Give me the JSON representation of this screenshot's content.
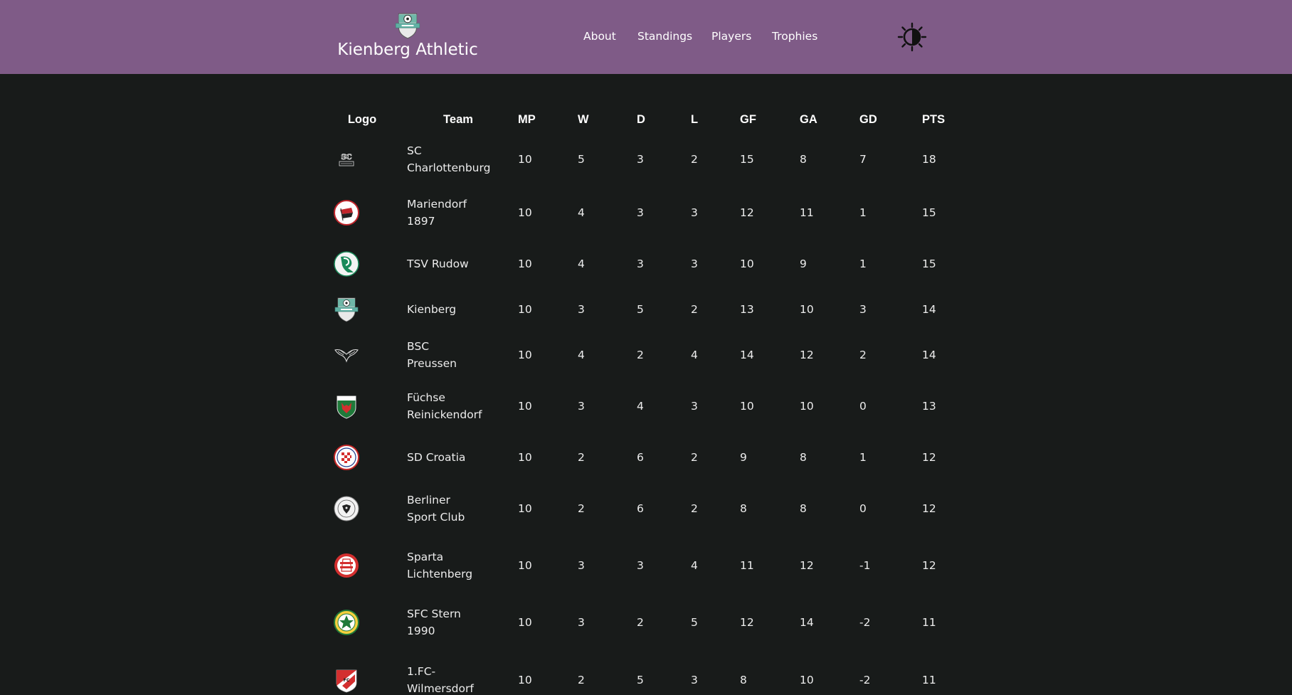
{
  "header": {
    "brand_name": "Kienberg Athletic",
    "logo_icon": "kienberg-crest-icon",
    "nav": [
      "About",
      "Standings",
      "Players",
      "Trophies"
    ],
    "theme_toggle_icon": "contrast-sun-icon",
    "colors": {
      "background": "#7f5b87"
    }
  },
  "table": {
    "columns": [
      "Logo",
      "Team",
      "MP",
      "W",
      "D",
      "L",
      "GF",
      "GA",
      "GD",
      "PTS"
    ],
    "rows": [
      {
        "logo": "sc-charlottenburg-crest-icon",
        "team": "SC Charlottenburg",
        "mp": "10",
        "w": "5",
        "d": "3",
        "l": "2",
        "gf": "15",
        "ga": "8",
        "gd": "7",
        "pts": "18"
      },
      {
        "logo": "mariendorf-1897-crest-icon",
        "team": "Mariendorf 1897",
        "mp": "10",
        "w": "4",
        "d": "3",
        "l": "3",
        "gf": "12",
        "ga": "11",
        "gd": "1",
        "pts": "15"
      },
      {
        "logo": "tsv-rudow-crest-icon",
        "team": "TSV Rudow",
        "mp": "10",
        "w": "4",
        "d": "3",
        "l": "3",
        "gf": "10",
        "ga": "9",
        "gd": "1",
        "pts": "15"
      },
      {
        "logo": "kienberg-crest-icon",
        "team": "Kienberg",
        "mp": "10",
        "w": "3",
        "d": "5",
        "l": "2",
        "gf": "13",
        "ga": "10",
        "gd": "3",
        "pts": "14"
      },
      {
        "logo": "bsc-preussen-crest-icon",
        "team": "BSC Preussen",
        "mp": "10",
        "w": "4",
        "d": "2",
        "l": "4",
        "gf": "14",
        "ga": "12",
        "gd": "2",
        "pts": "14"
      },
      {
        "logo": "fuechse-reinickendorf-crest-icon",
        "team": "Füchse Reinickendorf",
        "mp": "10",
        "w": "3",
        "d": "4",
        "l": "3",
        "gf": "10",
        "ga": "10",
        "gd": "0",
        "pts": "13"
      },
      {
        "logo": "sd-croatia-crest-icon",
        "team": "SD Croatia",
        "mp": "10",
        "w": "2",
        "d": "6",
        "l": "2",
        "gf": "9",
        "ga": "8",
        "gd": "1",
        "pts": "12"
      },
      {
        "logo": "berliner-sport-club-crest-icon",
        "team": "Berliner Sport Club",
        "mp": "10",
        "w": "2",
        "d": "6",
        "l": "2",
        "gf": "8",
        "ga": "8",
        "gd": "0",
        "pts": "12"
      },
      {
        "logo": "sparta-lichtenberg-crest-icon",
        "team": "Sparta Lichtenberg",
        "mp": "10",
        "w": "3",
        "d": "3",
        "l": "4",
        "gf": "11",
        "ga": "12",
        "gd": "-1",
        "pts": "12"
      },
      {
        "logo": "sfc-stern-1990-crest-icon",
        "team": "SFC Stern 1990",
        "mp": "10",
        "w": "3",
        "d": "2",
        "l": "5",
        "gf": "12",
        "ga": "14",
        "gd": "-2",
        "pts": "11"
      },
      {
        "logo": "1fc-wilmersdorf-crest-icon",
        "team": "1.FC-Wilmersdorf",
        "mp": "10",
        "w": "2",
        "d": "5",
        "l": "3",
        "gf": "8",
        "ga": "10",
        "gd": "-2",
        "pts": "11"
      }
    ]
  },
  "colors": {
    "page_background": "#181b1a",
    "text": "#ececec"
  }
}
